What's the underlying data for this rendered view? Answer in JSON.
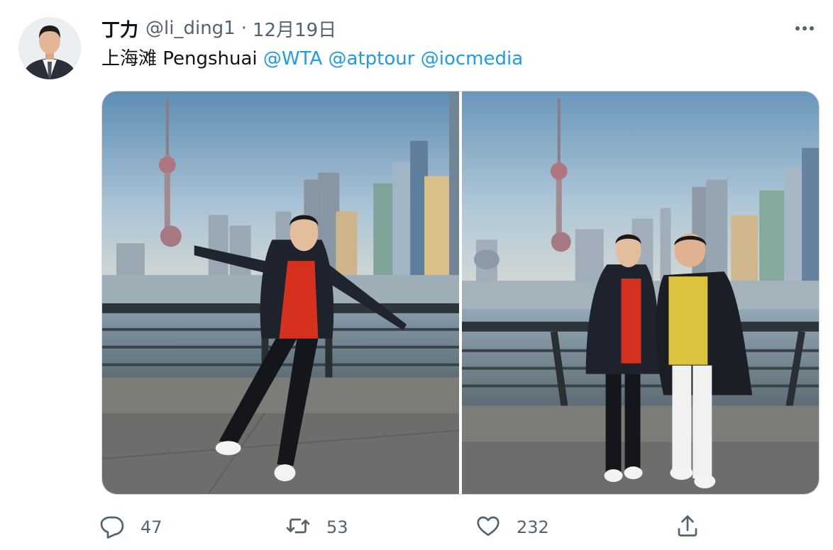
{
  "tweet": {
    "author": {
      "name": "丁力",
      "handle": "@li_ding1",
      "date": "12月19日"
    },
    "text": {
      "plain": "上海滩 Pengshuai ",
      "mentions": [
        "@WTA",
        "@atptour",
        "@iocmedia"
      ]
    },
    "media": {
      "count": 2
    },
    "actions": {
      "replies": "47",
      "retweets": "53",
      "likes": "232"
    }
  },
  "colors": {
    "link": "#1d9bf0",
    "secondary_text": "#536471",
    "primary_text": "#0f1419",
    "border": "#cfd9de"
  },
  "icons": [
    "more-icon",
    "reply-icon",
    "retweet-icon",
    "like-icon",
    "share-icon"
  ]
}
